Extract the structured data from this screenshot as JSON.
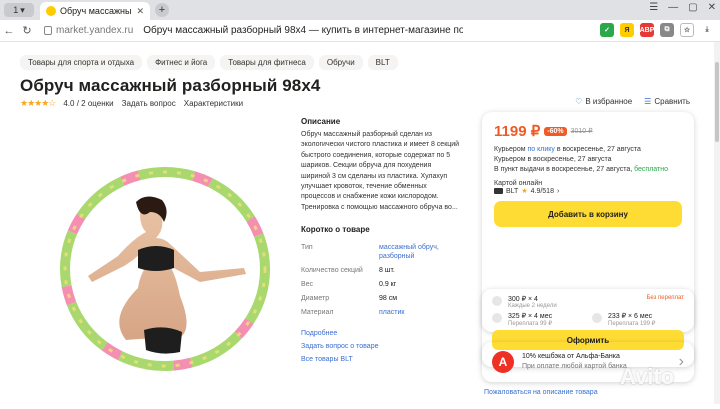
{
  "browser": {
    "tab_count": "1",
    "tab_title": "Обруч массажный разборный",
    "url_domain": "market.yandex.ru",
    "url_title": "Обруч массажный разборный 98x4 — купить в интернет-магазине по низкой...",
    "extensions": [
      "ABP"
    ]
  },
  "breadcrumbs": [
    "Товары для спорта и отдыха",
    "Фитнес и йога",
    "Товары для фитнеса",
    "Обручи",
    "BLT"
  ],
  "product": {
    "title": "Обруч массажный разборный 98x4",
    "rating_value": "4.0",
    "reviews": "/ 2 оценки",
    "ask_question": "Задать вопрос",
    "characteristics": "Характеристики",
    "favorite": "В избранное",
    "compare": "Сравнить"
  },
  "description": {
    "heading": "Описание",
    "text": "Обруч массажный разборный сделан из экологически чистого пластика и имеет 8 секций быстрого соединения, которые содержат по 5 шариков. Секции обруча для похудения шириной 3 см сделаны из пластика. Хулахуп улучшает кровоток, течение обменных процессов и снабжение кожи кислородом. Тренировка с помощью массажного обруча во..."
  },
  "specs": {
    "heading": "Коротко о товаре",
    "rows": [
      {
        "k": "Тип",
        "v": "массажный обруч, разборный",
        "link": true
      },
      {
        "k": "Количество секций",
        "v": "8 шт.",
        "link": false
      },
      {
        "k": "Вес",
        "v": "0.9 кг",
        "link": false
      },
      {
        "k": "Диаметр",
        "v": "98 см",
        "link": false
      },
      {
        "k": "Материал",
        "v": "пластик",
        "link": true
      }
    ],
    "more": "Подробнее",
    "ask": "Задать вопрос о товаре",
    "all_goods": "Все товары BLT"
  },
  "buy": {
    "price": "1199 ₽",
    "discount": "-60%",
    "old_price": "3010 ₽",
    "courier_1_prefix": "Курьером ",
    "courier_1_link": "по клику",
    "courier_1_suffix": " в воскресенье, 27 августа",
    "courier_2": "Курьером в воскресенье, 27 августа",
    "pickup_prefix": "В пункт выдачи в воскресенье, 27 августа, ",
    "pickup_free": "бесплатно",
    "card_online": "Картой онлайн",
    "seller": "BLT",
    "seller_rating": "4.9/518",
    "add_to_cart": "Добавить в корзину"
  },
  "split": {
    "opt1_price": "300 ₽ × 4",
    "opt1_sub": "Каждые 2 недели",
    "opt1_tag": "Без переплат",
    "opt2_price": "325 ₽ × 4 мес",
    "opt2_sub": "Переплата 99 ₽",
    "opt3_price": "233 ₽ × 6 мес",
    "opt3_sub": "Переплата 199 ₽",
    "order": "Оформить"
  },
  "cashback": {
    "logo": "А",
    "line1": "10% кешбэка от Альфа-Банка",
    "line2": "При оплате любой картой банка"
  },
  "complain": "Пожаловаться на описание товара",
  "watermark": "Avito"
}
